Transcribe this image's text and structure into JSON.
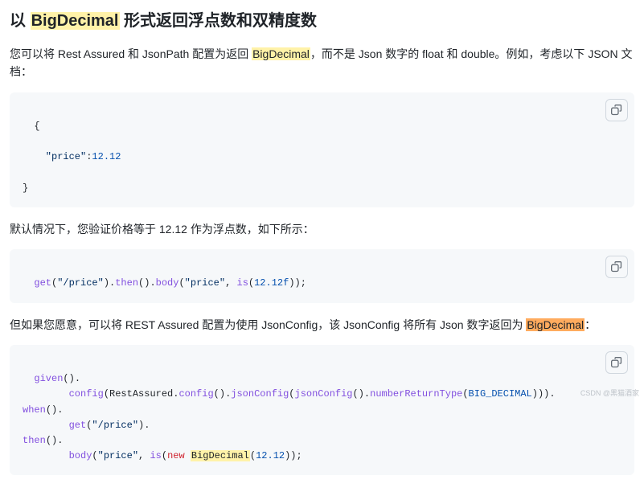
{
  "heading": {
    "prefix": "以 ",
    "highlight": "BigDecimal",
    "suffix": " 形式返回浮点数和双精度数"
  },
  "para1": {
    "part1": "您可以将 Rest Assured 和 JsonPath 配置为返回 ",
    "hl": "BigDecimal",
    "part2": "，而不是 Json 数字的 float 和 double。例如，考虑以下 JSON 文档："
  },
  "code1": {
    "brace_open": "{",
    "indent_key": "    \"price\"",
    "colon": ":",
    "value": "12.12",
    "brace_close": "}"
  },
  "para2": "默认情况下，您验证价格等于 12.12 作为浮点数，如下所示：",
  "code2": {
    "fn_get": "get",
    "s_price": "\"/price\"",
    "txt_then": ").",
    "fn_then": "then",
    "txt_body": "().",
    "fn_body": "body",
    "s_price2": "\"price\"",
    "txt_is": ", ",
    "fn_is": "is",
    "num": "12.12f",
    "end": "));"
  },
  "para3": {
    "part1": "但如果您愿意，可以将 REST Assured 配置为使用 JsonConfig，该 JsonConfig 将所有 Json 数字返回为 ",
    "hl": "BigDecimal",
    "part2": "："
  },
  "code3": {
    "l1_fn": "given",
    "l1_end": "().",
    "l2_pad": "        ",
    "l2_fn1": "config",
    "l2_txt1": "(RestAssured.",
    "l2_fn2": "config",
    "l2_txt2": "().",
    "l2_fn3": "jsonConfig",
    "l2_txt3": "(",
    "l2_fn4": "jsonConfig",
    "l2_txt4": "().",
    "l2_fn5": "numberReturnType",
    "l2_txt5": "(",
    "l2_const": "BIG_DECIMAL",
    "l2_end": "))).",
    "l3_fn": "when",
    "l3_end": "().",
    "l4_pad": "        ",
    "l4_fn": "get",
    "l4_s": "\"/price\"",
    "l4_end": ").",
    "l5_fn": "then",
    "l5_end": "().",
    "l6_pad": "        ",
    "l6_fn1": "body",
    "l6_s": "\"price\"",
    "l6_txt1": ", ",
    "l6_fn2": "is",
    "l6_txt2": "(",
    "l6_kw": "new",
    "l6_sp": " ",
    "l6_cls": "BigDecimal",
    "l6_txt3": "(",
    "l6_num": "12.12",
    "l6_end": "));"
  },
  "watermark": "CSDN @黑猫酒家"
}
